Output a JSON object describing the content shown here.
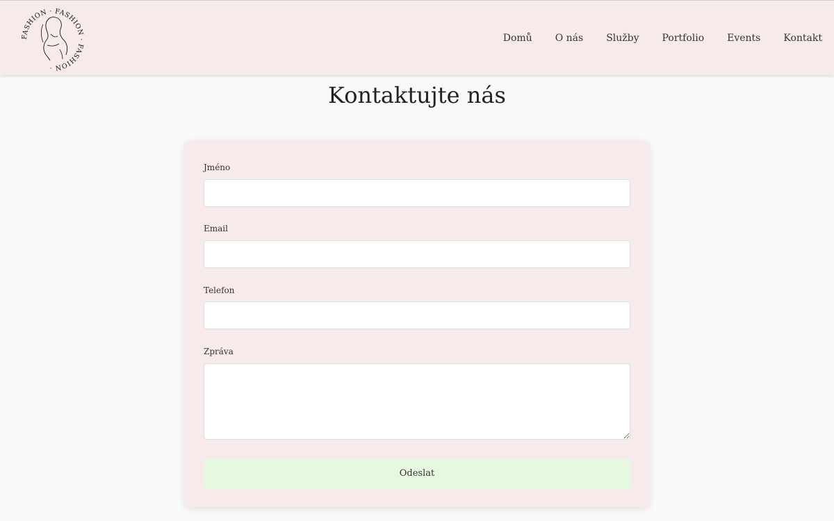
{
  "logo": {
    "ring_text": "FASHION · FASHION · FASHION ·",
    "icon": "woman-line-art-icon"
  },
  "nav": {
    "items": [
      {
        "label": "Domů"
      },
      {
        "label": "O nás"
      },
      {
        "label": "Služby"
      },
      {
        "label": "Portfolio"
      },
      {
        "label": "Events"
      },
      {
        "label": "Kontakt"
      }
    ]
  },
  "page": {
    "title": "Kontaktujte nás"
  },
  "form": {
    "name": {
      "label": "Jméno",
      "value": ""
    },
    "email": {
      "label": "Email",
      "value": ""
    },
    "phone": {
      "label": "Telefon",
      "value": ""
    },
    "message": {
      "label": "Zpráva",
      "value": ""
    },
    "submit_label": "Odeslat"
  },
  "colors": {
    "header_bg": "#f7eaea",
    "page_bg": "#f9f9f9",
    "card_bg": "#f7eaea",
    "button_bg": "#e7f8e2"
  }
}
